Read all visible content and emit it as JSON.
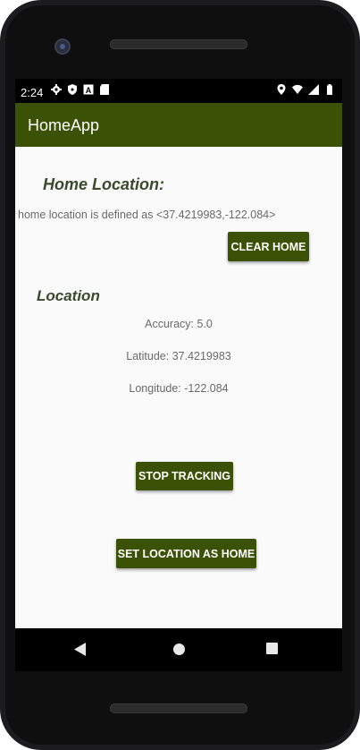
{
  "status_bar": {
    "time": "2:24",
    "left_icons": [
      "gear-icon",
      "shield-icon",
      "font-a-icon",
      "sd-card-icon"
    ],
    "right_icons": [
      "location-pin-icon",
      "wifi-icon",
      "signal-icon",
      "battery-icon"
    ]
  },
  "app_bar": {
    "title": "HomeApp"
  },
  "home_section": {
    "heading": "Home Location:",
    "description": "home location is defined as <37.4219983,-122.084>",
    "clear_button": "CLEAR HOME"
  },
  "location_section": {
    "heading": "Location",
    "accuracy": "Accuracy: 5.0",
    "latitude": "Latitude: 37.4219983",
    "longitude": "Longitude: -122.084"
  },
  "actions": {
    "stop_button": "STOP TRACKING",
    "set_home_button": "SET LOCATION AS HOME"
  },
  "nav_bar": {
    "buttons": [
      "back-icon",
      "home-icon",
      "recents-icon"
    ]
  },
  "colors": {
    "primary": "#3b5106",
    "background": "#fafafa"
  }
}
